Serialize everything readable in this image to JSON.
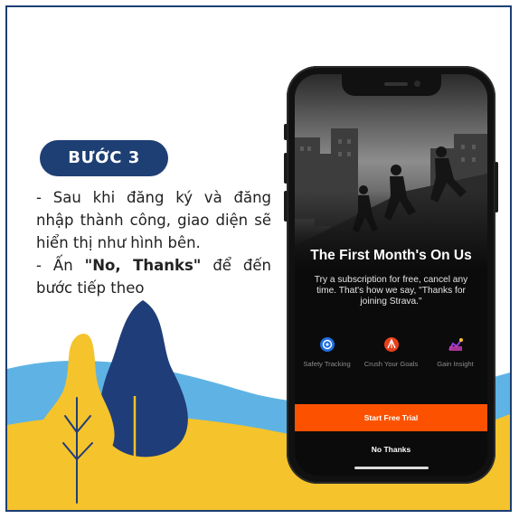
{
  "step_label": "BƯỚC 3",
  "instructions": {
    "line1": "- Sau khi đăng ký và đăng nhập thành công, giao diện sẽ hiển thị như hình bên.",
    "line2_prefix": "- Ấn ",
    "line2_bold": "\"No, Thanks\"",
    "line2_suffix": " để đến bước tiếp theo"
  },
  "phone": {
    "title": "The First Month's On Us",
    "subtitle": "Try a subscription for free, cancel any time. That's how we say, \"Thanks for joining Strava.\"",
    "features": [
      {
        "icon": "safety-tracking-icon",
        "label": "Safety Tracking"
      },
      {
        "icon": "crush-goals-icon",
        "label": "Crush Your Goals"
      },
      {
        "icon": "gain-insight-icon",
        "label": "Gain Insight"
      }
    ],
    "primary_button": "Start Free Trial",
    "secondary_button": "No Thanks",
    "accent": "#fc5200"
  },
  "colors": {
    "navy": "#1e3f74",
    "yellow": "#f5c32c",
    "light_blue": "#5fb3e4"
  }
}
